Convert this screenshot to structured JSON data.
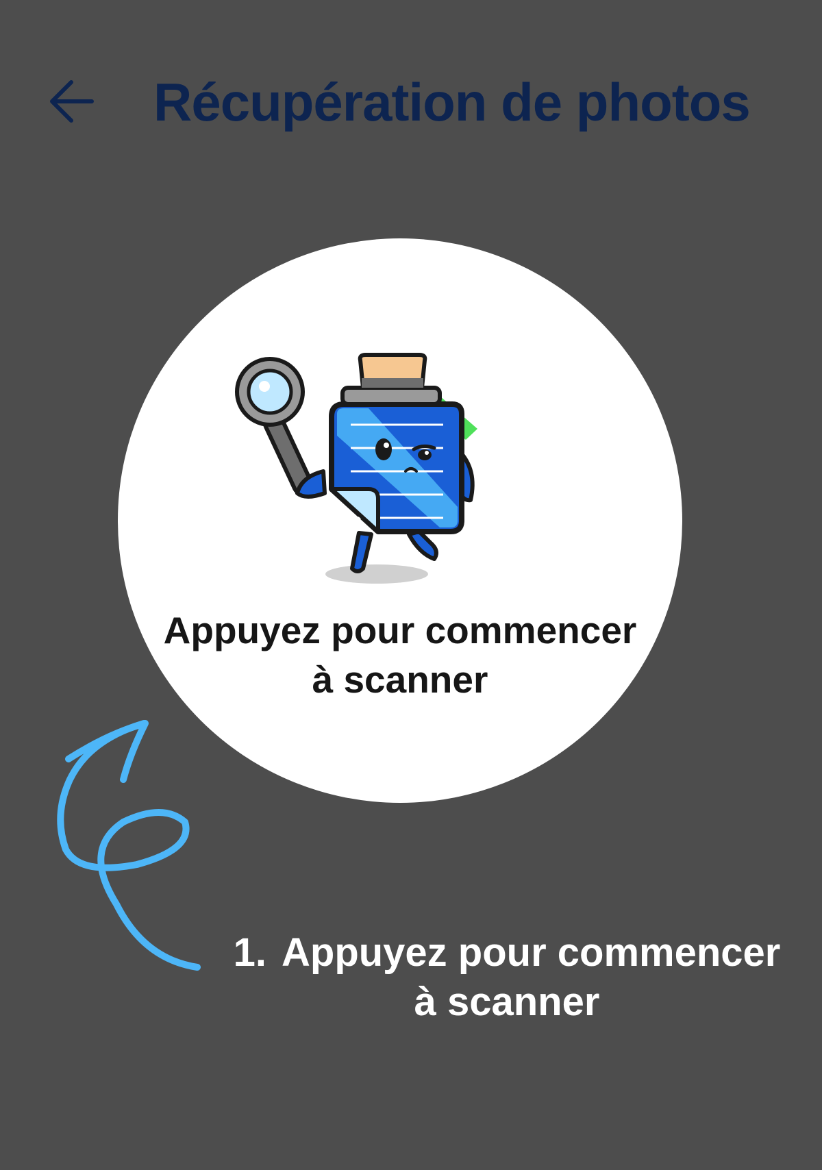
{
  "header": {
    "title": "Récupération de photos",
    "back_icon": "arrow-left-icon"
  },
  "scan_button": {
    "line1": "Appuyez pour commencer",
    "line2": "à scanner",
    "illustration": "detective-note-mascot"
  },
  "hint": {
    "number": "1.",
    "line1": "Appuyez pour commencer",
    "line2": "à scanner",
    "arrow_icon": "curved-arrow-icon"
  },
  "colors": {
    "background": "#4d4d4d",
    "title": "#0d2450",
    "accent_arrow": "#4db6f8"
  }
}
